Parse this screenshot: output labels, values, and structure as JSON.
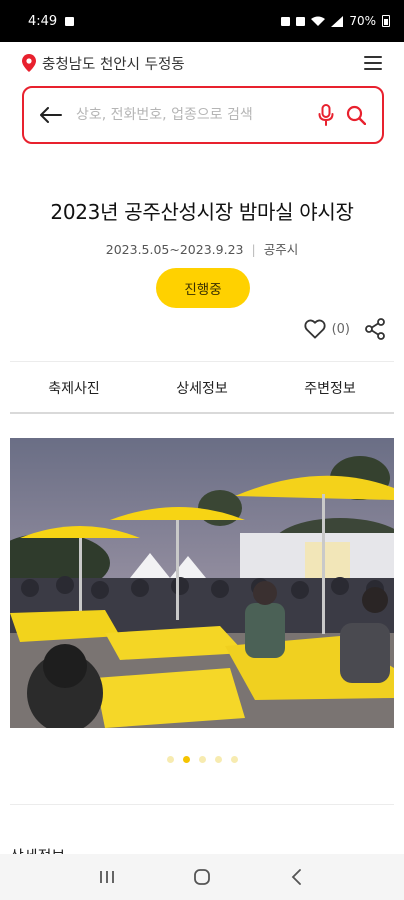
{
  "status_bar": {
    "time": "4:49",
    "battery": "70%"
  },
  "location": {
    "text": "충청남도 천안시 두정동"
  },
  "search": {
    "placeholder": "상호, 전화번호, 업종으로 검색"
  },
  "event": {
    "title": "2023년 공주산성시장 밤마실 야시장",
    "date_range": "2023.5.05~2023.9.23",
    "city": "공주시",
    "status": "진행중",
    "like_count": "(0)"
  },
  "tabs": [
    {
      "label": "축제사진"
    },
    {
      "label": "상세정보"
    },
    {
      "label": "주변정보"
    }
  ],
  "carousel": {
    "total": 5,
    "active_index": 1
  },
  "section": {
    "peek_label": "상세정보"
  },
  "colors": {
    "accent_red": "#e8212e",
    "accent_yellow": "#ffd100"
  },
  "icons": [
    "location-pin-icon",
    "menu-icon",
    "back-arrow-icon",
    "microphone-icon",
    "search-icon",
    "heart-icon",
    "share-icon",
    "recent-apps-icon",
    "home-icon",
    "back-icon"
  ]
}
